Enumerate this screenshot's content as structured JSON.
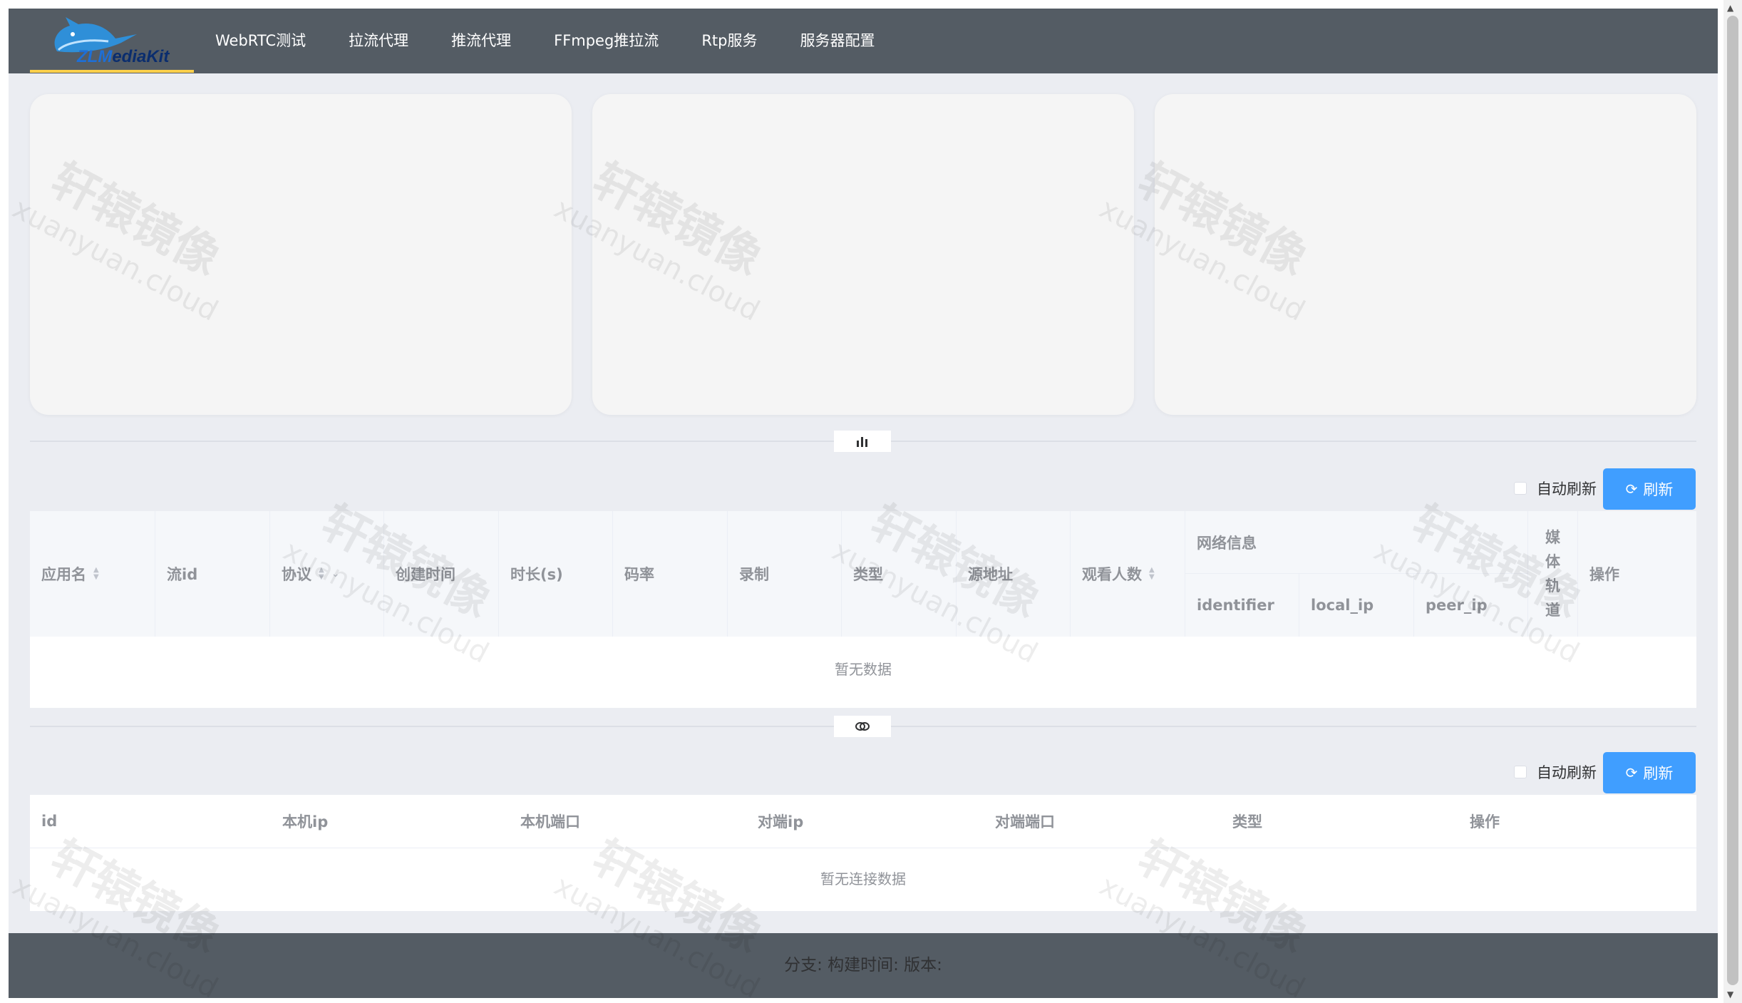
{
  "brand": {
    "logo_text_a": "ZLM",
    "logo_text_b": "ediaKit",
    "logo_text_c": "Kit"
  },
  "nav": {
    "items": [
      {
        "label": "WebRTC测试"
      },
      {
        "label": "拉流代理"
      },
      {
        "label": "推流代理"
      },
      {
        "label": "FFmpeg推拉流"
      },
      {
        "label": "Rtp服务"
      },
      {
        "label": "服务器配置"
      }
    ],
    "active_indicator_color": "#ffd04b"
  },
  "dividers": {
    "chart_icon": "bar-chart-icon",
    "link_icon": "link-icon"
  },
  "stream_section": {
    "auto_refresh_label": "自动刷新",
    "refresh_label": "刷新",
    "columns": {
      "app": "应用名",
      "stream": "流id",
      "protocol": "协议",
      "created": "创建时间",
      "duration": "时长(s)",
      "bitrate": "码率",
      "record": "录制",
      "type": "类型",
      "source": "源地址",
      "viewers": "观看人数",
      "network": "网络信息",
      "identifier": "identifier",
      "local_ip": "local_ip",
      "peer_ip": "peer_ip",
      "tracks": "媒体轨道",
      "actions": "操作"
    },
    "empty_text": "暂无数据"
  },
  "conn_section": {
    "auto_refresh_label": "自动刷新",
    "refresh_label": "刷新",
    "columns": {
      "id": "id",
      "local_ip": "本机ip",
      "local_port": "本机端口",
      "peer_ip": "对端ip",
      "peer_port": "对端端口",
      "type": "类型",
      "actions": "操作"
    },
    "empty_text": "暂无连接数据"
  },
  "footer": {
    "text": "分支:  构建时间: 版本:"
  },
  "watermark": {
    "cn": "轩辕镜像",
    "en": "xuanyuan.cloud"
  },
  "colors": {
    "header_bg": "#545c64",
    "primary": "#409eff",
    "page_bg": "#ebedf2"
  }
}
